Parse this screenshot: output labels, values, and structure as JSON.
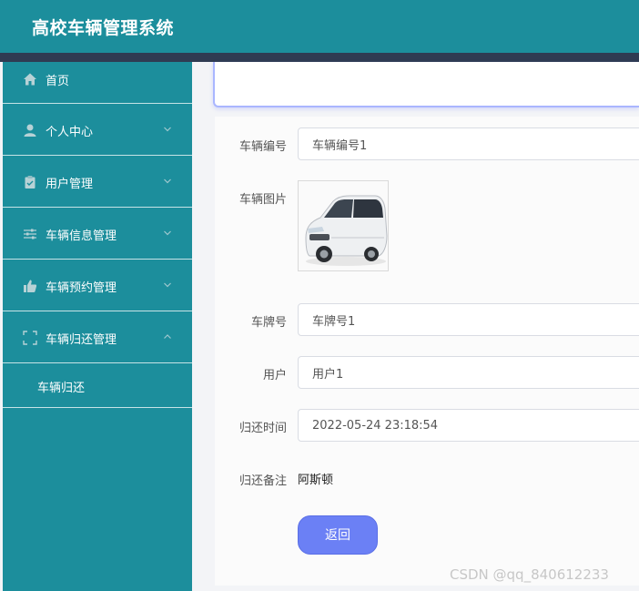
{
  "header": {
    "title": "高校车辆管理系统"
  },
  "sidebar": {
    "items": [
      {
        "label": "首页",
        "icon": "home-icon"
      },
      {
        "label": "个人中心",
        "icon": "user-icon"
      },
      {
        "label": "用户管理",
        "icon": "clipboard-icon"
      },
      {
        "label": "车辆信息管理",
        "icon": "sliders-icon"
      },
      {
        "label": "车辆预约管理",
        "icon": "thumb-icon"
      },
      {
        "label": "车辆归还管理",
        "icon": "fullscreen-icon"
      }
    ],
    "sub_items": [
      {
        "label": "车辆归还"
      }
    ]
  },
  "form": {
    "vehicle_no": {
      "label": "车辆编号",
      "value": "车辆编号1"
    },
    "vehicle_image": {
      "label": "车辆图片"
    },
    "plate_no": {
      "label": "车牌号",
      "value": "车牌号1"
    },
    "user": {
      "label": "用户",
      "value": "用户1"
    },
    "return_time": {
      "label": "归还时间",
      "value": "2022-05-24 23:18:54"
    },
    "return_note": {
      "label": "归还备注",
      "value": "阿斯顿"
    },
    "back_button": "返回"
  },
  "watermark": "CSDN @qq_840612233",
  "colors": {
    "header": "#1c8e9c",
    "sidebar": "#1c8e9c",
    "stripe": "#2f3b52",
    "button": "#6b80f5"
  }
}
